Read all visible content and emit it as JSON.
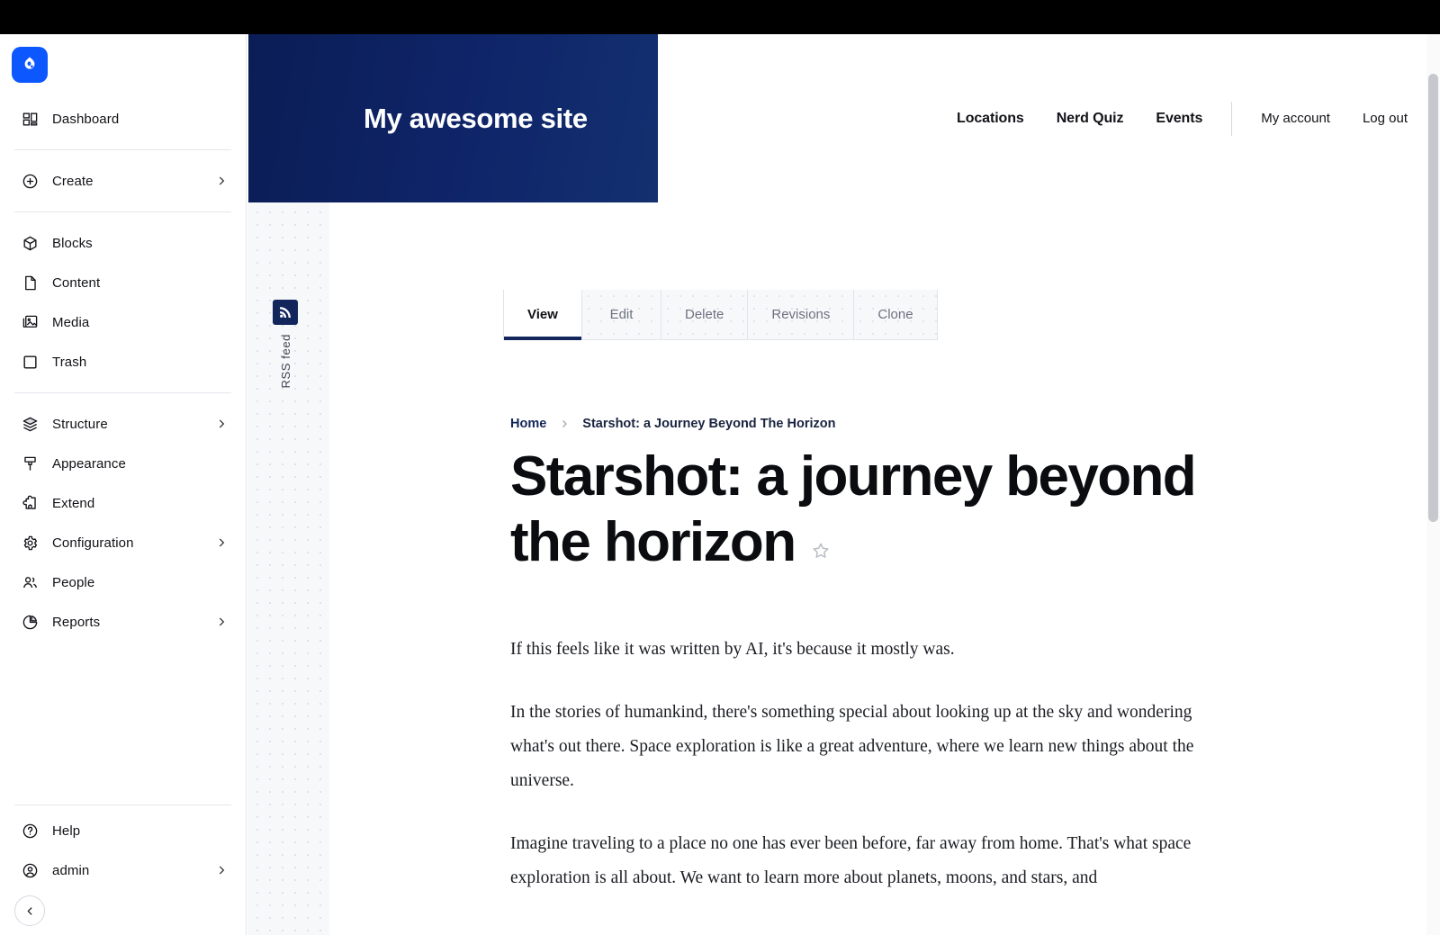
{
  "admin_sidebar": {
    "logo_icon": "drupal-droplet-icon",
    "groups": [
      {
        "items": [
          {
            "label": "Dashboard",
            "icon": "dashboard-icon",
            "expandable": false
          }
        ]
      },
      {
        "items": [
          {
            "label": "Create",
            "icon": "plus-circle-icon",
            "expandable": true
          }
        ]
      },
      {
        "items": [
          {
            "label": "Blocks",
            "icon": "cube-icon",
            "expandable": false
          },
          {
            "label": "Content",
            "icon": "file-icon",
            "expandable": false
          },
          {
            "label": "Media",
            "icon": "image-icon",
            "expandable": false
          },
          {
            "label": "Trash",
            "icon": "trash-square-icon",
            "expandable": false
          }
        ]
      },
      {
        "items": [
          {
            "label": "Structure",
            "icon": "layers-icon",
            "expandable": true
          },
          {
            "label": "Appearance",
            "icon": "paintbrush-icon",
            "expandable": false
          },
          {
            "label": "Extend",
            "icon": "puzzle-icon",
            "expandable": false
          },
          {
            "label": "Configuration",
            "icon": "gear-icon",
            "expandable": true
          },
          {
            "label": "People",
            "icon": "people-icon",
            "expandable": false
          },
          {
            "label": "Reports",
            "icon": "pie-chart-icon",
            "expandable": true
          }
        ]
      }
    ],
    "footer_items": [
      {
        "label": "Help",
        "icon": "question-circle-icon",
        "expandable": false
      },
      {
        "label": "admin",
        "icon": "user-circle-icon",
        "expandable": true
      }
    ],
    "collapse_button_icon": "chevron-left-icon"
  },
  "site_header": {
    "title": "My awesome site",
    "background_color": "#0f2569",
    "main_nav": [
      {
        "label": "Locations"
      },
      {
        "label": "Nerd Quiz"
      },
      {
        "label": "Events"
      }
    ],
    "user_nav": [
      {
        "label": "My account"
      },
      {
        "label": "Log out"
      }
    ]
  },
  "rss": {
    "icon": "rss-feed-icon",
    "label": "RSS feed"
  },
  "tabs": [
    {
      "label": "View",
      "active": true
    },
    {
      "label": "Edit",
      "active": false
    },
    {
      "label": "Delete",
      "active": false
    },
    {
      "label": "Revisions",
      "active": false
    },
    {
      "label": "Clone",
      "active": false
    }
  ],
  "breadcrumb": {
    "home": "Home",
    "separator_icon": "chevron-right-icon",
    "current": "Starshot: a Journey Beyond The Horizon"
  },
  "article": {
    "title": "Starshot: a journey beyond the horizon",
    "bookmark_icon": "star-outline-icon",
    "paragraphs": [
      "If this feels like it was written by AI, it's because it mostly was.",
      "In the stories of humankind, there's something special about looking up at the sky and wondering what's out there. Space exploration is like a great adventure, where we learn new things about the universe.",
      "Imagine traveling to a place no one has ever been before, far away from home. That's what space exploration is all about. We want to learn more about planets, moons, and stars, and"
    ]
  },
  "colors": {
    "brand_blue": "#0d57ff",
    "header_navy": "#0f2569",
    "accent_navy": "#12265c"
  }
}
